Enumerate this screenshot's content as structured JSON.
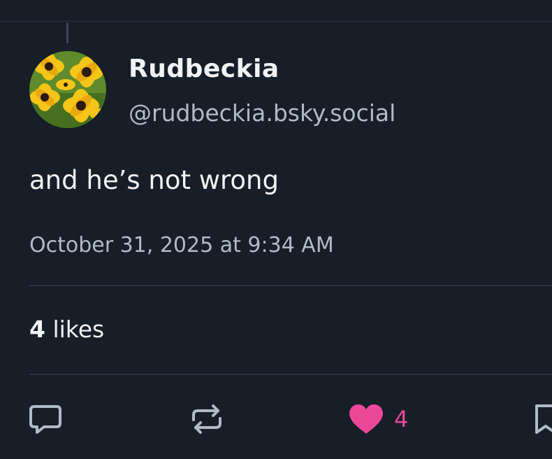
{
  "author": {
    "display_name": "Rudbeckia",
    "handle": "@rudbeckia.bsky.social"
  },
  "post": {
    "text": "and he’s not wrong",
    "timestamp": "October 31, 2025 at 9:34 AM"
  },
  "stats": {
    "likes_count": "4",
    "likes_label": "likes"
  },
  "actions": {
    "reply_icon": "speech-bubble-icon",
    "repost_icon": "repost-arrows-icon",
    "like_icon": "heart-icon",
    "like_count": "4",
    "more_icon": "bookmark-icon"
  },
  "colors": {
    "background": "#161e27",
    "text": "#f1f3f5",
    "muted": "#aebbc9",
    "liked": "#ec4899"
  }
}
